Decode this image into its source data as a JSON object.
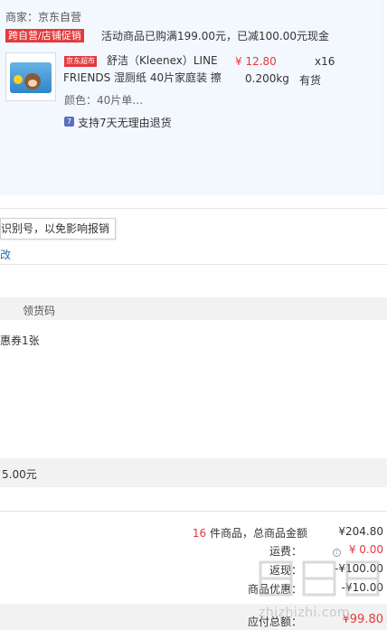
{
  "product_section": {
    "merchant": "商家：京东自营",
    "promo_tag": "跨自营/店铺促销",
    "promo_text": "活动商品已购满199.00元，已减100.00元现金",
    "item": {
      "jd_tag": "京东超市",
      "name": "舒洁（Kleenex）LINE FRIENDS 湿厕纸 40片家庭装 擦",
      "price": "¥ 12.80",
      "quantity": "x16",
      "weight": "0.200kg",
      "stock": "有货",
      "color_spec": "颜色：40片单…",
      "return_policy": "支持7天无理由退货",
      "return_icon": "7"
    }
  },
  "invoice": {
    "tooltip": "识别号，以免影响报销",
    "link_fragment": "改"
  },
  "pickup": {
    "header_label": "领货码",
    "coupon_fragment": "惠券1张"
  },
  "amount_fragment": "5.00元",
  "summary": {
    "count": "16",
    "count_suffix": " 件商品，总商品金额",
    "goods_total": "¥204.80",
    "shipping_label": "运费：",
    "shipping_value": "¥ 0.00",
    "discount_label": "返现：",
    "discount_value": "-¥100.00",
    "coupon_label": "商品优惠：",
    "coupon_value": "-¥10.00",
    "payable_label": "应付总额：",
    "payable_value": "¥99.80"
  },
  "watermark": {
    "text": "zhizhizhi.com",
    "glyphs": "值值值"
  },
  "colors": {
    "accent_red": "#e4393c",
    "link_blue": "#2a6fb3",
    "panel_bg": "#f3f8fe",
    "grey_bg": "#f2f2f2"
  }
}
